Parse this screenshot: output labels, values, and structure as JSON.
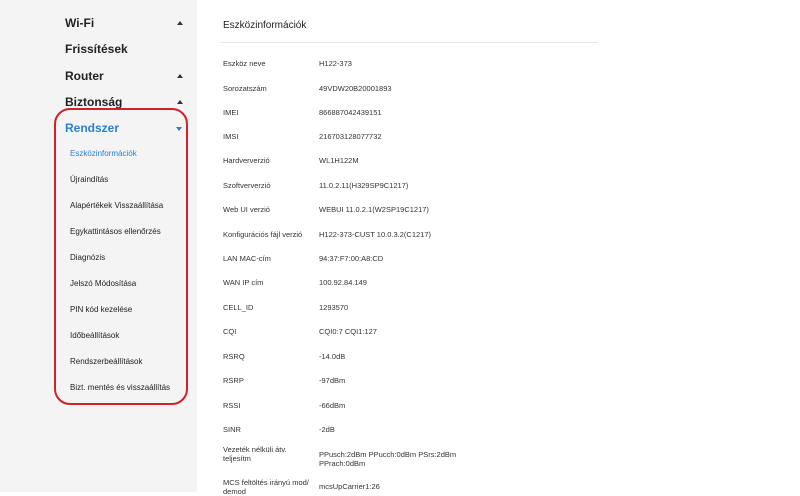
{
  "sidebar": {
    "wifi": "Wi-Fi",
    "updates": "Frissítések",
    "router": "Router",
    "security": "Biztonság",
    "system": "Rendszer",
    "system_items": [
      "Eszközinformációk",
      "Újraindítás",
      "Alapértékek Visszaállítása",
      "Egykattintásos ellenőrzés",
      "Diagnózis",
      "Jelszó Módosítása",
      "PIN kód kezelése",
      "Időbeállítások",
      "Rendszerbeállítások",
      "Bizt. mentés és visszaállítás"
    ]
  },
  "main": {
    "title": "Eszközinformációk",
    "rows": [
      {
        "label": "Eszköz neve",
        "value": "H122-373"
      },
      {
        "label": "Sorozatszám",
        "value": "49VDW20B20001893"
      },
      {
        "label": "IMEI",
        "value": "866887042439151"
      },
      {
        "label": "IMSI",
        "value": "216703128077732"
      },
      {
        "label": "Hardververzió",
        "value": "WL1H122M"
      },
      {
        "label": "Szoftververzió",
        "value": "11.0.2.11(H329SP9C1217)"
      },
      {
        "label": "Web UI verzió",
        "value": "WEBUI 11.0.2.1(W2SP19C1217)"
      },
      {
        "label": "Konfigurációs fájl verzió",
        "value": "H122-373-CUST 10.0.3.2(C1217)"
      },
      {
        "label": "LAN MAC-cím",
        "value": "94:37:F7:00:A8:CD"
      },
      {
        "label": "WAN IP cím",
        "value": "100.92.84.149"
      },
      {
        "label": "CELL_ID",
        "value": "1293570"
      },
      {
        "label": "CQI",
        "value": "CQI0:7 CQI1:127"
      },
      {
        "label": "RSRQ",
        "value": "-14.0dB"
      },
      {
        "label": "RSRP",
        "value": "-97dBm"
      },
      {
        "label": "RSSI",
        "value": "-66dBm"
      },
      {
        "label": "SINR",
        "value": "-2dB"
      },
      {
        "label": "Vezeték nélküli átv. teljesítm",
        "value": "PPusch:2dBm PPucch:0dBm PSrs:2dBm\nPPrach:0dBm"
      },
      {
        "label": "MCS feltöltés irányú mod/ demod",
        "value": "mcsUpCarrier1:26"
      }
    ]
  }
}
